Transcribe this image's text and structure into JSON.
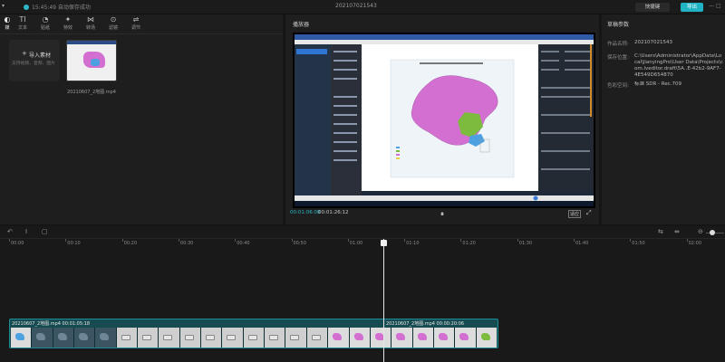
{
  "topbar": {
    "menu_icon": "menu-icon",
    "save_time": "15:45:49",
    "save_status": "自动保存成功",
    "project_title": "202107021543",
    "shortcut_label": "快捷键",
    "export_label": "导出",
    "window_controls": "— □"
  },
  "toolbar": {
    "items": [
      {
        "label": "媒",
        "icon": "media-icon",
        "glyph": "◐"
      },
      {
        "label": "文本",
        "icon": "text-icon",
        "glyph": "TI"
      },
      {
        "label": "贴纸",
        "icon": "sticker-icon",
        "glyph": "◔"
      },
      {
        "label": "特效",
        "icon": "effects-icon",
        "glyph": "✦"
      },
      {
        "label": "转场",
        "icon": "transition-icon",
        "glyph": "⋈"
      },
      {
        "label": "滤镜",
        "icon": "filter-icon",
        "glyph": "⊙"
      },
      {
        "label": "调节",
        "icon": "adjust-icon",
        "glyph": "⇌"
      }
    ]
  },
  "media": {
    "import_label": "导入素材",
    "import_hint": "支持视频、音频、图片",
    "clip_name": "20210607_2地图.mp4"
  },
  "player": {
    "title": "播放器",
    "current_time": "00:01:06:08",
    "total_time": "00:01:26:12",
    "ratio_label": "适应"
  },
  "params": {
    "title": "草稿参数",
    "rows": [
      {
        "key": "作品名称:",
        "value": "202107021543"
      },
      {
        "key": "保存位置:",
        "value": "C:\\Users\\Administrator\\AppData\\Local\\JianyingPro\\User Data\\Projects\\com.lveditor.draft\\5A..E-42b2-9AF7-4E549D654870"
      },
      {
        "key": "色彩空间:",
        "value": "标准 SDR - Rec.709"
      }
    ]
  },
  "timeline": {
    "ruler": [
      "00:00",
      "00:10",
      "00:20",
      "00:30",
      "00:40",
      "00:50",
      "01:00",
      "01:10",
      "01:20",
      "01:30",
      "01:40",
      "01:50",
      "02:00"
    ],
    "clips": [
      {
        "name": "20210607_2地图.mp4",
        "duration": "00:01:05:18"
      },
      {
        "name": "20210607_2地图.mp4",
        "duration": "00:00:20:06"
      }
    ]
  },
  "colors": {
    "accent": "#1fb3c4",
    "clip_bg": "#164b52",
    "map_pink": "#d26fd0",
    "map_green": "#7dbb3f",
    "map_blue": "#4da1e0"
  }
}
